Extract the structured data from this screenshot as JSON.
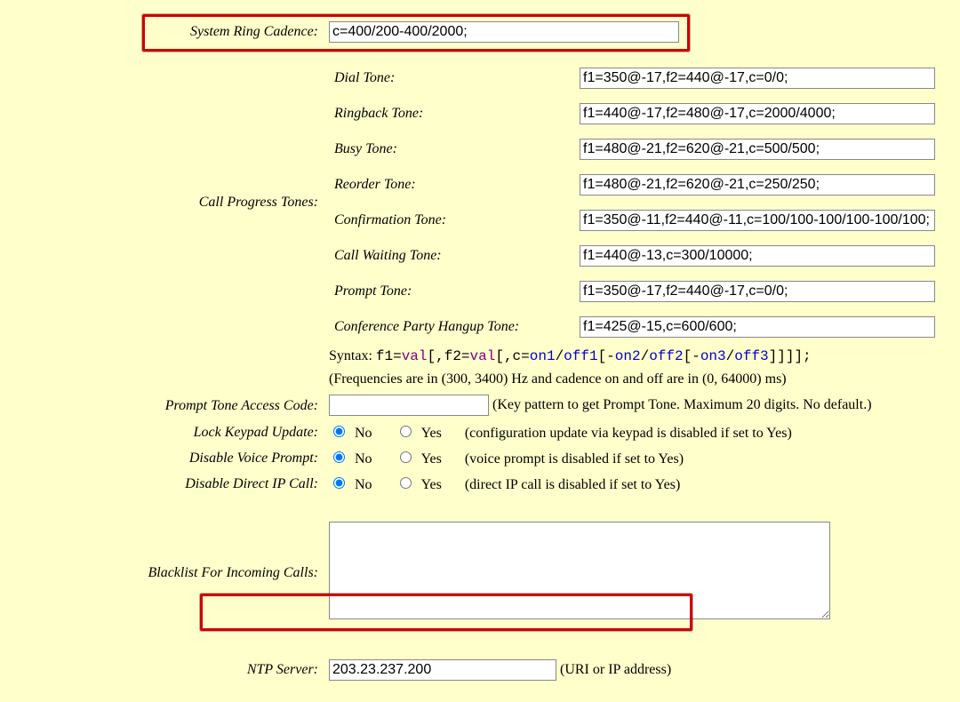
{
  "ring_cadence": {
    "label": "System Ring Cadence:",
    "value": "c=400/200-400/2000;"
  },
  "progress": {
    "section_label": "Call Progress Tones:",
    "tones": {
      "dial": {
        "label": "Dial Tone:",
        "value": "f1=350@-17,f2=440@-17,c=0/0;"
      },
      "ringback": {
        "label": "Ringback Tone:",
        "value": "f1=440@-17,f2=480@-17,c=2000/4000;"
      },
      "busy": {
        "label": "Busy Tone:",
        "value": "f1=480@-21,f2=620@-21,c=500/500;"
      },
      "reorder": {
        "label": "Reorder Tone:",
        "value": "f1=480@-21,f2=620@-21,c=250/250;"
      },
      "confirm": {
        "label": "Confirmation Tone:",
        "value": "f1=350@-11,f2=440@-11,c=100/100-100/100-100/100;"
      },
      "callwait": {
        "label": "Call Waiting Tone:",
        "value": "f1=440@-13,c=300/10000;"
      },
      "prompt": {
        "label": "Prompt Tone:",
        "value": "f1=350@-17,f2=440@-17,c=0/0;"
      },
      "confhang": {
        "label": "Conference Party Hangup Tone:",
        "value": "f1=425@-15,c=600/600;"
      }
    },
    "syntax_prefix": "Syntax: ",
    "syntax_freq_note": "(Frequencies are in (300, 3400) Hz and cadence on and off are in (0, 64000) ms)"
  },
  "prompt_access": {
    "label": "Prompt Tone Access Code:",
    "value": "",
    "note": "(Key pattern to get Prompt Tone. Maximum 20 digits. No default.)"
  },
  "radios": {
    "lock_keypad": {
      "label": "Lock Keypad Update:",
      "note": "(configuration update via keypad is disabled if set to Yes)"
    },
    "voice_prompt": {
      "label": "Disable Voice Prompt:",
      "note": "(voice prompt is disabled if set to Yes)"
    },
    "direct_ip": {
      "label": "Disable Direct IP Call:",
      "note": "(direct IP call is disabled if set to Yes)"
    },
    "no": "No",
    "yes": "Yes"
  },
  "blacklist": {
    "label": "Blacklist For Incoming Calls:",
    "value": ""
  },
  "ntp": {
    "label": "NTP Server:",
    "value": "203.23.237.200",
    "note": "(URI or IP address)"
  }
}
